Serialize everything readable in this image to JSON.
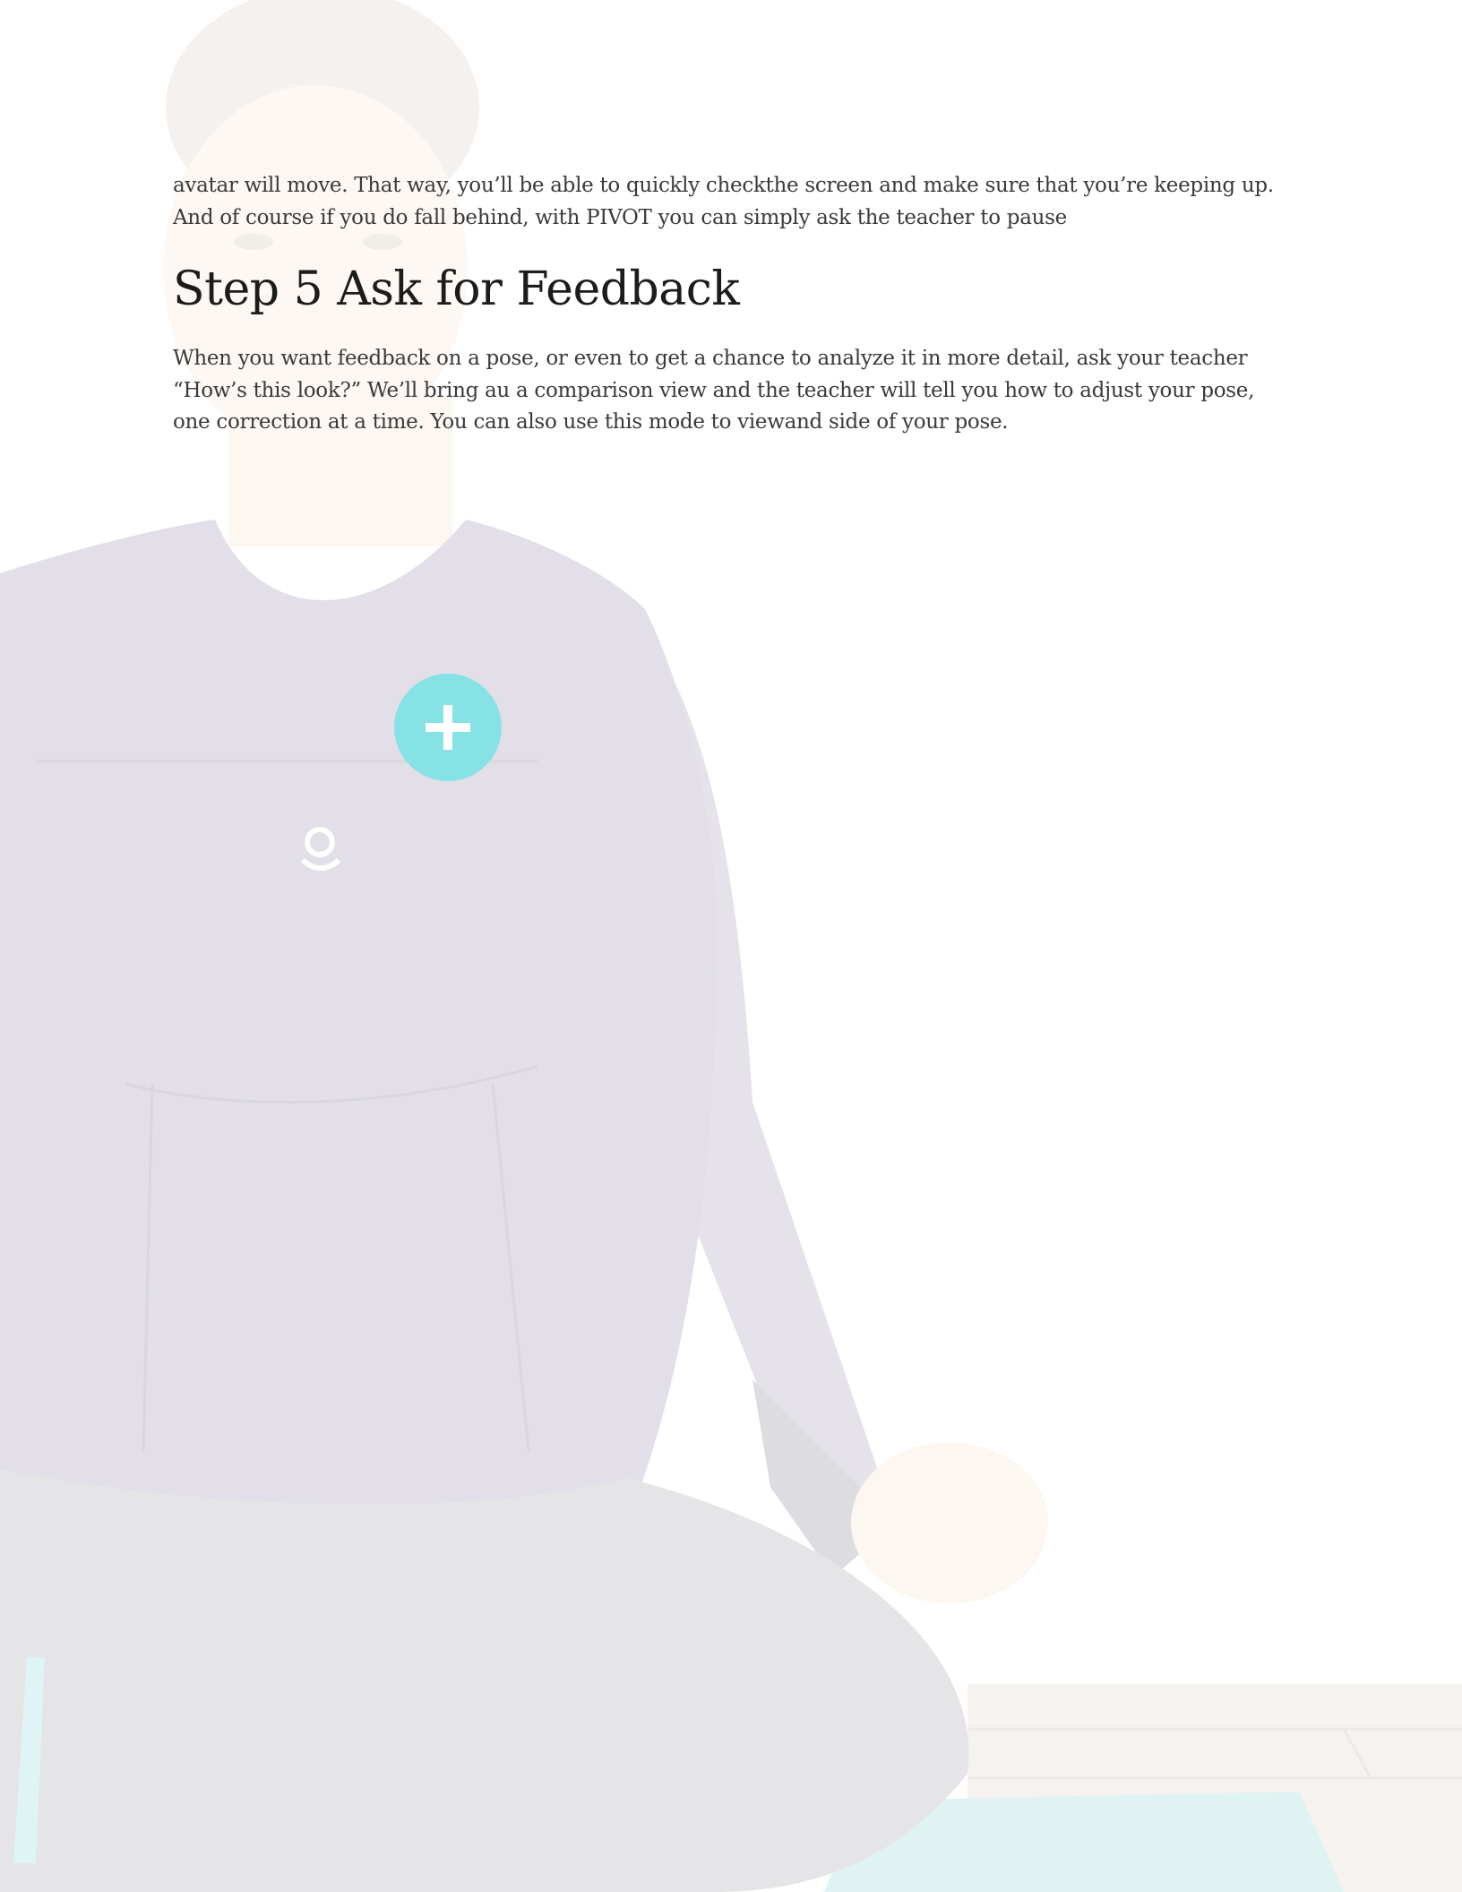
{
  "document": {
    "intro_paragraph": "avatar will move. That way, you’ll be able to quickly checkthe screen and make sure that you’re keeping up. And of course if you do fall behind, with PIVOT you can simply ask the teacher to pause",
    "heading": "Step 5 Ask for Feedback",
    "feedback_paragraph": "When you want feedback on a pose, or even to get a chance to analyze it in more detail, ask your teacher “How’s this look?”  We’ll bring au a comparison view and the teacher will tell you how to adjust your pose, one correction at a time. You can also use this mode to viewand side of your pose."
  },
  "background": {
    "icons": [
      "plus-icon",
      "pivot-logo-icon"
    ],
    "colors": {
      "accent": "#5fd8dc",
      "shirt": "#d7d3e0",
      "pants": "#d9d9dc",
      "skin": "#fbf3ea",
      "floor": "#f0ece8",
      "mat": "#cfeeee"
    }
  }
}
